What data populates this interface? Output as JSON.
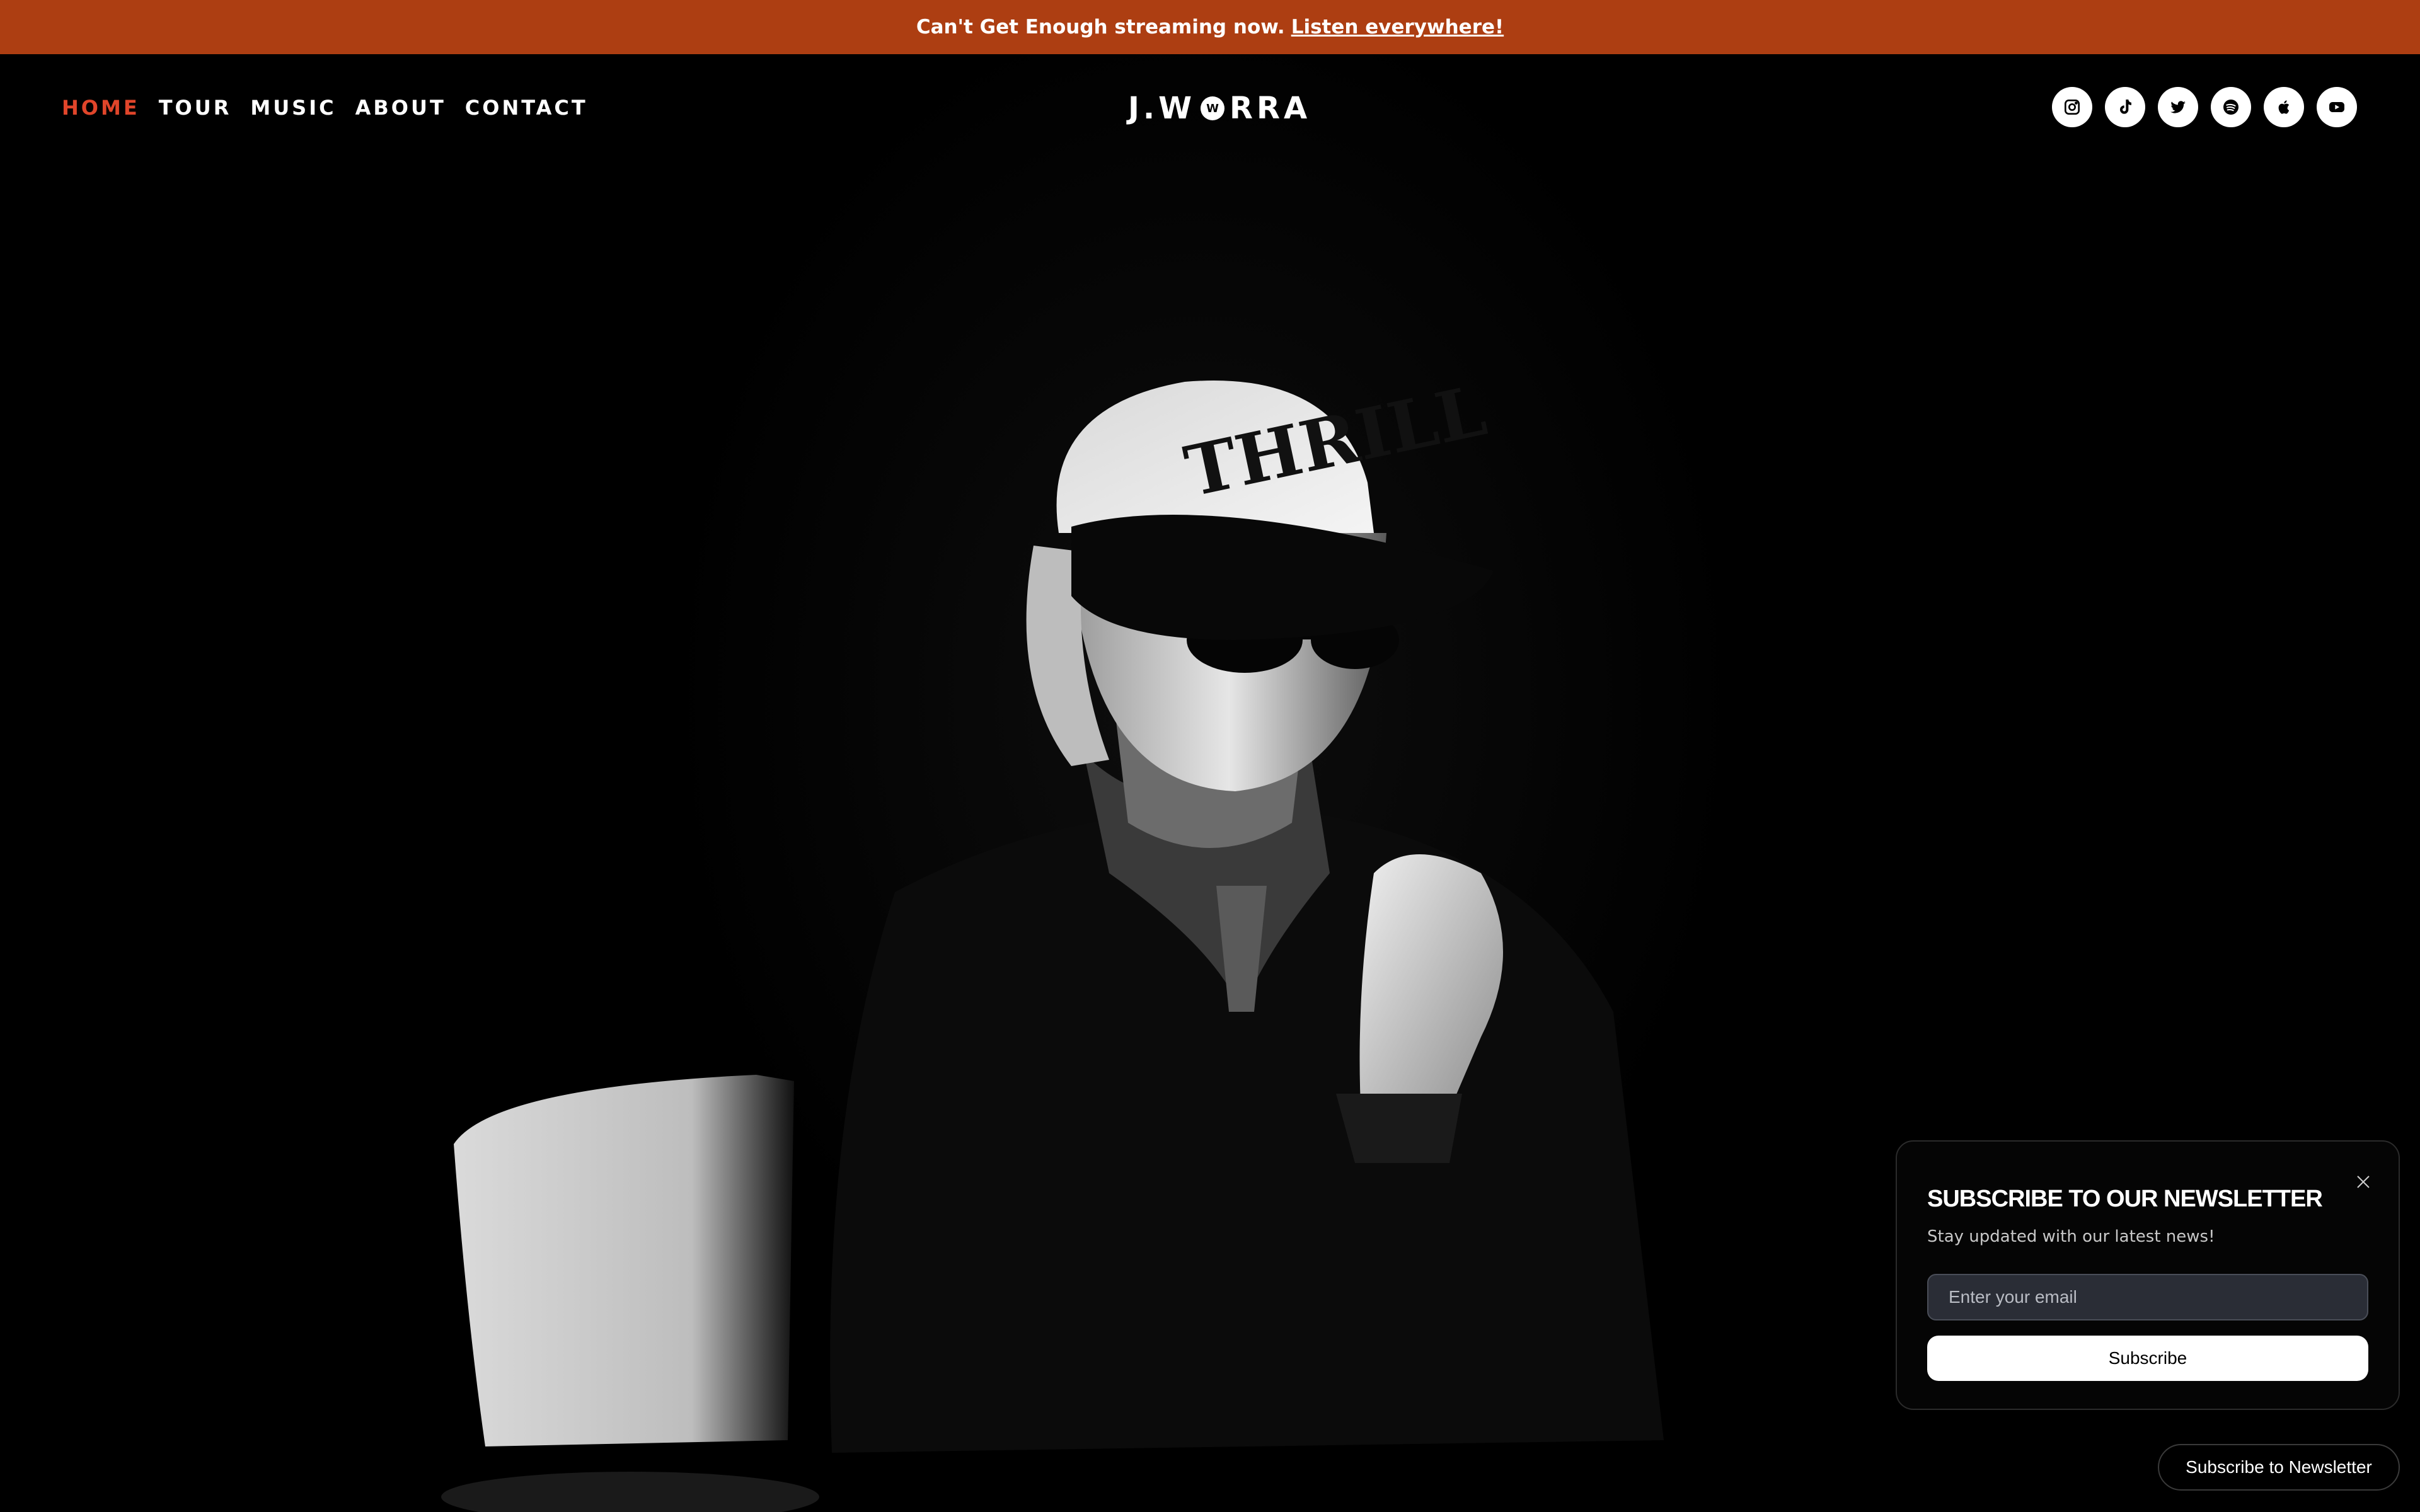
{
  "announcement": {
    "text": "Can't Get Enough streaming now.",
    "link": "Listen everywhere!"
  },
  "nav": {
    "items": [
      {
        "label": "HOME",
        "active": true
      },
      {
        "label": "TOUR",
        "active": false
      },
      {
        "label": "MUSIC",
        "active": false
      },
      {
        "label": "ABOUT",
        "active": false
      },
      {
        "label": "CONTACT",
        "active": false
      }
    ]
  },
  "logo": {
    "left": "J.W",
    "mark": "W",
    "right": "RRA"
  },
  "socials": [
    {
      "name": "instagram-icon"
    },
    {
      "name": "tiktok-icon"
    },
    {
      "name": "twitter-icon"
    },
    {
      "name": "spotify-icon"
    },
    {
      "name": "apple-music-icon"
    },
    {
      "name": "youtube-icon"
    }
  ],
  "hero": {
    "cap_text": "THRILL"
  },
  "newsletter": {
    "title": "SUBSCRIBE TO OUR NEWSLETTER",
    "subtitle": "Stay updated with our latest news!",
    "email_placeholder": "Enter your email",
    "button_label": "Subscribe"
  },
  "newsletter_pill": {
    "label": "Subscribe to Newsletter"
  },
  "colors": {
    "announcement_bg": "#ad3e12",
    "active_nav": "#e0452a"
  }
}
